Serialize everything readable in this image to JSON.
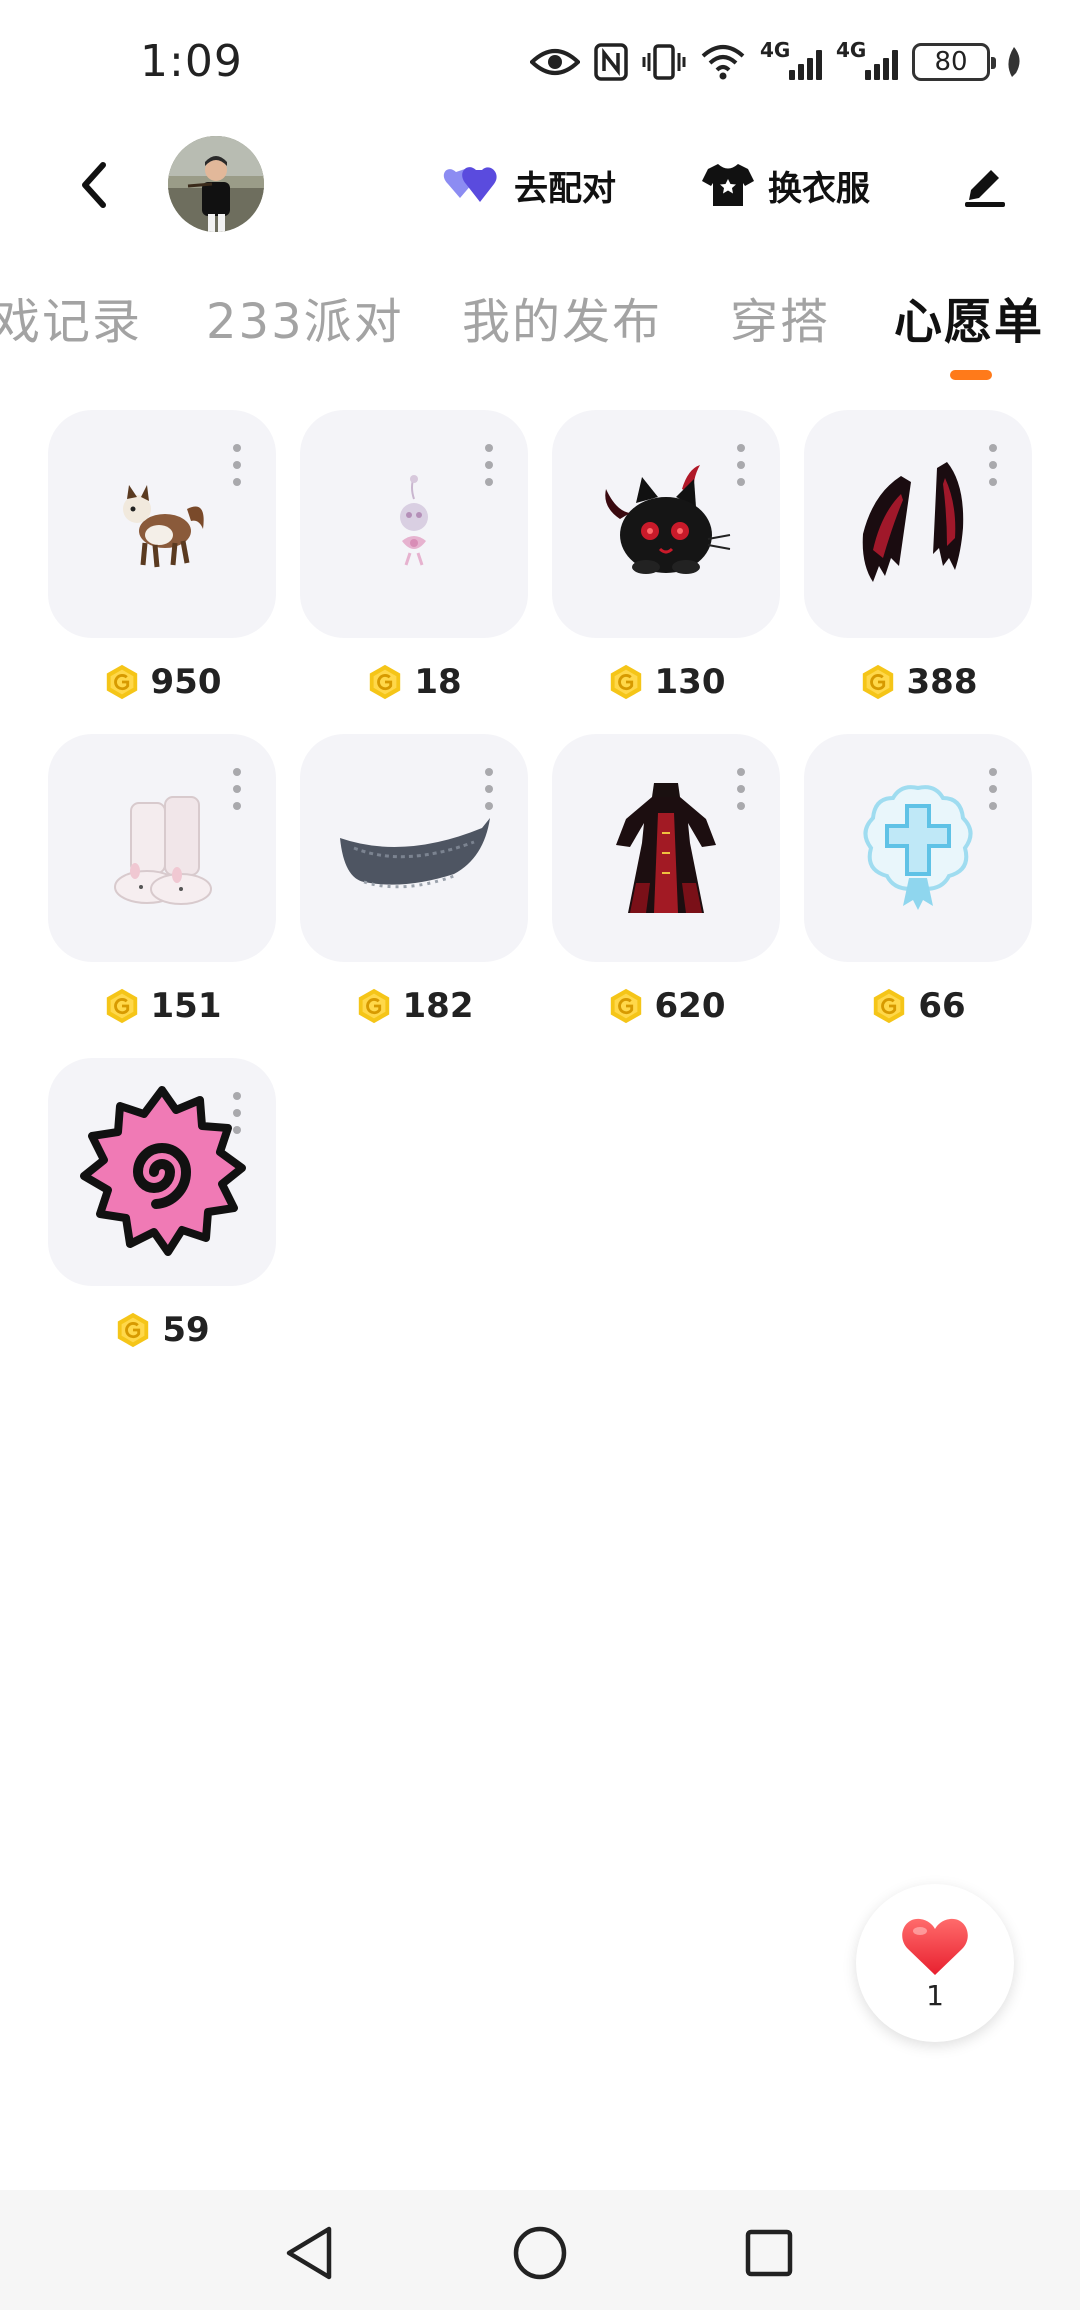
{
  "status_bar": {
    "time": "1:09",
    "icons": [
      "eye-icon",
      "nfc-icon",
      "vibrate-icon",
      "wifi-icon",
      "signal-4g-icon",
      "signal-4g-icon",
      "battery-icon",
      "leaf-icon"
    ],
    "network_1": "4G",
    "network_2": "4G",
    "battery": "80"
  },
  "header": {
    "back_icon": "back-arrow-icon",
    "pair_label": "去配对",
    "pair_icon": "hearts-icon",
    "outfit_label": "换衣服",
    "outfit_icon": "shirt-icon",
    "edit_icon": "pen-icon"
  },
  "tabs": [
    {
      "label": "戏记录",
      "active": false
    },
    {
      "label": "233派对",
      "active": false
    },
    {
      "label": "我的发布",
      "active": false
    },
    {
      "label": "穿搭",
      "active": false
    },
    {
      "label": "心愿单",
      "active": true
    }
  ],
  "accent_color": "#ff7a1a",
  "coin_color": "#f2c100",
  "wishlist": [
    {
      "name": "fox-pet",
      "price": "950"
    },
    {
      "name": "pink-charm",
      "price": "18"
    },
    {
      "name": "devil-cat-hat",
      "price": "130"
    },
    {
      "name": "bat-wings",
      "price": "388"
    },
    {
      "name": "bunny-boots",
      "price": "151"
    },
    {
      "name": "grey-scarf",
      "price": "182"
    },
    {
      "name": "red-black-dress",
      "price": "620"
    },
    {
      "name": "blue-cross-badge",
      "price": "66"
    },
    {
      "name": "pink-swirl-sticker",
      "price": "59"
    }
  ],
  "fab": {
    "icon": "heart-icon",
    "count": "1"
  },
  "navbar": {
    "back": "triangle-back-icon",
    "home": "circle-home-icon",
    "recents": "square-recents-icon"
  }
}
